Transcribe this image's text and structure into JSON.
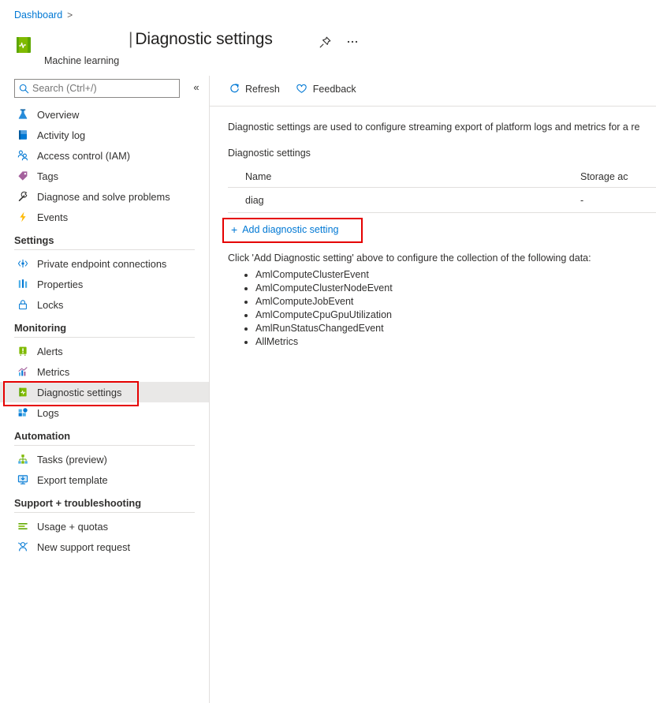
{
  "breadcrumb": {
    "items": [
      "Dashboard"
    ],
    "separator": ">"
  },
  "resource": {
    "icon": "machine-learning-icon",
    "name": "Machine learning",
    "title": "Diagnostic settings",
    "title_prefix": "|",
    "pin_icon": "pin-icon",
    "more_icon": "ellipsis-icon"
  },
  "search": {
    "placeholder": "Search (Ctrl+/)",
    "value": "",
    "icon": "search-icon"
  },
  "collapse": {
    "icon": "double-chevron-left-icon",
    "label": "«"
  },
  "sidebar": {
    "items": [
      {
        "label": "Overview",
        "icon": "flask-icon",
        "type": "item"
      },
      {
        "label": "Activity log",
        "icon": "book-icon",
        "type": "item"
      },
      {
        "label": "Access control (IAM)",
        "icon": "people-icon",
        "type": "item"
      },
      {
        "label": "Tags",
        "icon": "tag-icon",
        "type": "item"
      },
      {
        "label": "Diagnose and solve problems",
        "icon": "wrench-icon",
        "type": "item"
      },
      {
        "label": "Events",
        "icon": "lightning-icon",
        "type": "item"
      },
      {
        "label": "Settings",
        "type": "group"
      },
      {
        "label": "Private endpoint connections",
        "icon": "private-endpoint-icon",
        "type": "item"
      },
      {
        "label": "Properties",
        "icon": "properties-icon",
        "type": "item"
      },
      {
        "label": "Locks",
        "icon": "lock-icon",
        "type": "item"
      },
      {
        "label": "Monitoring",
        "type": "group"
      },
      {
        "label": "Alerts",
        "icon": "alert-icon",
        "type": "item"
      },
      {
        "label": "Metrics",
        "icon": "metrics-chart-icon",
        "type": "item"
      },
      {
        "label": "Diagnostic settings",
        "icon": "diagnostic-settings-icon",
        "type": "item",
        "selected": true,
        "highlighted": true
      },
      {
        "label": "Logs",
        "icon": "logs-icon",
        "type": "item"
      },
      {
        "label": "Automation",
        "type": "group"
      },
      {
        "label": "Tasks (preview)",
        "icon": "tasks-icon",
        "type": "item"
      },
      {
        "label": "Export template",
        "icon": "export-template-icon",
        "type": "item"
      },
      {
        "label": "Support + troubleshooting",
        "type": "group"
      },
      {
        "label": "Usage + quotas",
        "icon": "usage-quotas-icon",
        "type": "item"
      },
      {
        "label": "New support request",
        "icon": "support-request-icon",
        "type": "item"
      }
    ]
  },
  "toolbar": {
    "refresh_label": "Refresh",
    "refresh_icon": "refresh-icon",
    "feedback_label": "Feedback",
    "feedback_icon": "heart-icon"
  },
  "main": {
    "description": "Diagnostic settings are used to configure streaming export of platform logs and metrics for a re",
    "section_label": "Diagnostic settings",
    "table": {
      "columns": [
        "Name",
        "Storage ac"
      ],
      "rows": [
        {
          "name": "diag",
          "storage_account": "-"
        }
      ]
    },
    "add_link": {
      "label": "Add diagnostic setting",
      "plus": "+"
    },
    "follow_text": "Click 'Add Diagnostic setting' above to configure the collection of the following data:",
    "data_items": [
      "AmlComputeClusterEvent",
      "AmlComputeClusterNodeEvent",
      "AmlComputeJobEvent",
      "AmlComputeCpuGpuUtilization",
      "AmlRunStatusChangedEvent",
      "AllMetrics"
    ]
  },
  "colors": {
    "link": "#0078d4",
    "highlight": "#e50000",
    "selected_row": "#e9e8e7",
    "divider": "#e1dfdd",
    "text": "#323130"
  }
}
